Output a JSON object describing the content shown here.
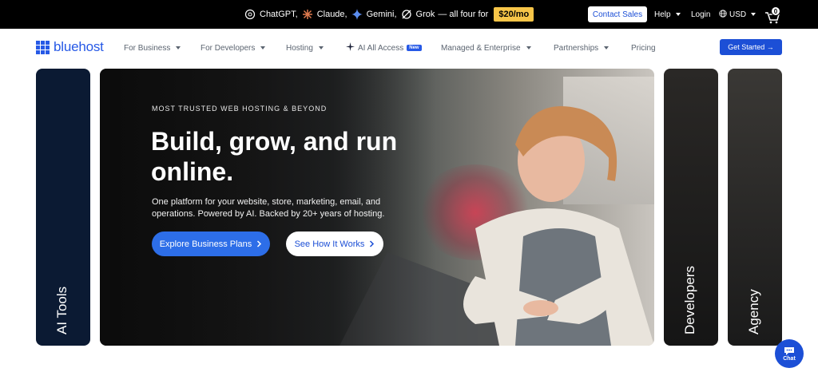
{
  "topbar": {
    "models": [
      "ChatGPT,",
      "Claude,",
      "Gemini,",
      "Grok"
    ],
    "tail_text": "— all four for",
    "price": "$20/mo",
    "contact_sales": "Contact Sales",
    "help": "Help",
    "login": "Login",
    "currency": "USD",
    "cart_count": "0"
  },
  "nav": {
    "logo": "bluehost",
    "items": [
      "For Business",
      "For Developers",
      "Hosting",
      "AI All Access",
      "Managed & Enterprise",
      "Partnerships",
      "Pricing"
    ],
    "new_badge": "New",
    "get_started": "Get Started →"
  },
  "hero": {
    "eyebrow": "MOST TRUSTED WEB HOSTING & BEYOND",
    "title": "Build, grow, and run online.",
    "subtitle": "One platform for your website, store, marketing, email, and operations. Powered by AI. Backed by 20+ years of hosting.",
    "primary_cta": "Explore Business Plans",
    "secondary_cta": "See How It Works"
  },
  "side_cards": {
    "left": "AI Tools",
    "right1": "Developers",
    "right2": "Agency"
  },
  "chat": {
    "label": "Chat"
  },
  "colors": {
    "brand_blue": "#2659e6",
    "cta_blue": "#2d6ee8",
    "badge_yellow": "#f7c548",
    "card_navy": "#0b1a33"
  }
}
